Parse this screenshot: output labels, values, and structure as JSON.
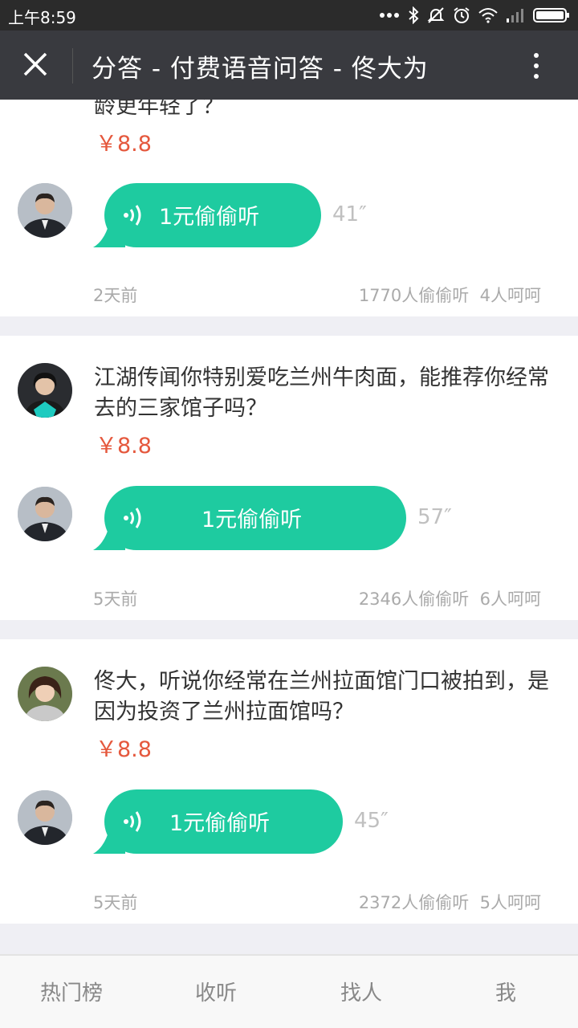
{
  "status_bar": {
    "time": "上午8:59",
    "icons": [
      "dots-icon",
      "bluetooth-icon",
      "mute-icon",
      "alarm-icon",
      "wifi-icon",
      "signal-icon",
      "battery-icon"
    ]
  },
  "header": {
    "title": "分答 - 付费语音问答 - 佟大为",
    "background": "#393a3f"
  },
  "colors": {
    "accent": "#1ecba0",
    "price": "#e5583d",
    "muted": "#aaaaaa"
  },
  "feed": [
    {
      "question": "龄更年轻了？",
      "price": "￥8.8",
      "listen_label": "1元偷偷听",
      "duration": "41″",
      "time": "2天前",
      "listeners": "1770人偷偷听",
      "likes": "4人呵呵"
    },
    {
      "question": "江湖传闻你特别爱吃兰州牛肉面，能推荐你经常去的三家馆子吗？",
      "price": "￥8.8",
      "listen_label": "1元偷偷听",
      "duration": "57″",
      "time": "5天前",
      "listeners": "2346人偷偷听",
      "likes": "6人呵呵"
    },
    {
      "question": "佟大，听说你经常在兰州拉面馆门口被拍到，是因为投资了兰州拉面馆吗？",
      "price": "￥8.8",
      "listen_label": "1元偷偷听",
      "duration": "45″",
      "time": "5天前",
      "listeners": "2372人偷偷听",
      "likes": "5人呵呵"
    }
  ],
  "bottom_nav": [
    {
      "label": "热门榜"
    },
    {
      "label": "收听"
    },
    {
      "label": "找人"
    },
    {
      "label": "我"
    }
  ]
}
